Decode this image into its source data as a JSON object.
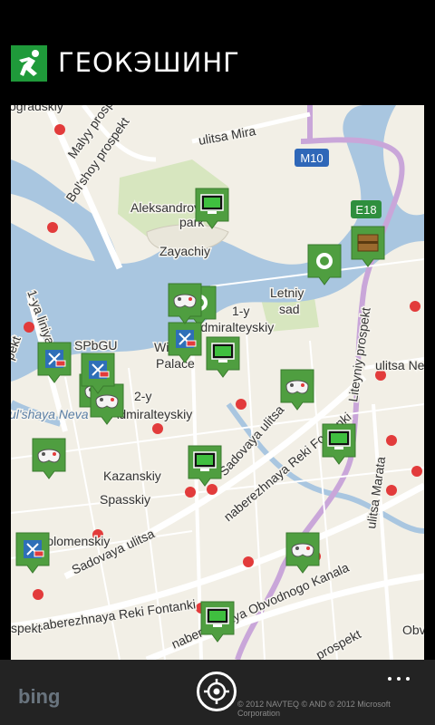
{
  "app": {
    "title": "ГЕОКЭШИНГ",
    "icon": "running-man-icon",
    "accent": "#1f9a3a"
  },
  "map": {
    "labels": [
      {
        "id": "l1",
        "text": "Malyy prospekt"
      },
      {
        "id": "l2",
        "text": "Bol'shoy prospekt"
      },
      {
        "id": "l3",
        "text": "ulitsa Mira"
      },
      {
        "id": "l4",
        "text": "Aleksandrovskiy"
      },
      {
        "id": "l5",
        "text": "park"
      },
      {
        "id": "l6",
        "text": "Zayachiy"
      },
      {
        "id": "l7",
        "text": "1-ya liniya"
      },
      {
        "id": "l8",
        "text": "SPbGU"
      },
      {
        "id": "l9",
        "text": "1-y"
      },
      {
        "id": "l10",
        "text": "Admiralteyskiy"
      },
      {
        "id": "l11",
        "text": "Letniy"
      },
      {
        "id": "l12",
        "text": "sad"
      },
      {
        "id": "l13",
        "text": "Liteyniy prospekt"
      },
      {
        "id": "l14",
        "text": "ulitsa Ne"
      },
      {
        "id": "l15",
        "text": "Winter"
      },
      {
        "id": "l16",
        "text": "Palace"
      },
      {
        "id": "l17",
        "text": "2-y"
      },
      {
        "id": "l18",
        "text": "Admiralteyskiy"
      },
      {
        "id": "l19",
        "text": "Sadovaya ulitsa"
      },
      {
        "id": "l20",
        "text": "naberezhnaya Reki Fontanki"
      },
      {
        "id": "l21",
        "text": "Kazanskiy"
      },
      {
        "id": "l22",
        "text": "Spasskiy"
      },
      {
        "id": "l23",
        "text": "ulitsa Marata"
      },
      {
        "id": "l24",
        "text": "Sadovaya ulitsa"
      },
      {
        "id": "l25",
        "text": "naberezhnaya Reki Fontanki"
      },
      {
        "id": "l26",
        "text": "naberezhnaya Obvodnogo Kanala"
      },
      {
        "id": "l27",
        "text": "naberezhnaya"
      },
      {
        "id": "l28",
        "text": "prospekt"
      },
      {
        "id": "l29",
        "text": "spekt"
      },
      {
        "id": "l30",
        "text": "Kolomenskiy"
      },
      {
        "id": "l31",
        "text": "ogradskiy"
      },
      {
        "id": "l32",
        "text": "pekt"
      },
      {
        "id": "l33",
        "text": "Obv"
      },
      {
        "id": "l34",
        "text": "ul'shaya Neva"
      }
    ],
    "road_shields": {
      "m10": "M10",
      "e18": "E18"
    },
    "colors": {
      "water": "#a9c6e0",
      "land": "#f2efe6",
      "green": "#cfe3b2",
      "road_major": "#ffffff",
      "road_purple": "#c9a6d9",
      "metro": "#e23b3b",
      "marker_green": "#4f9e40"
    },
    "markers": [
      {
        "id": "m1",
        "type": "virtual"
      },
      {
        "id": "m2",
        "type": "traditional"
      },
      {
        "id": "m3",
        "type": "mystery"
      },
      {
        "id": "m4",
        "type": "traditional"
      },
      {
        "id": "m5",
        "type": "multi"
      },
      {
        "id": "m6",
        "type": "event"
      },
      {
        "id": "m7",
        "type": "event"
      },
      {
        "id": "m8",
        "type": "multi"
      },
      {
        "id": "m9",
        "type": "multi"
      },
      {
        "id": "m10",
        "type": "virtual"
      },
      {
        "id": "m11",
        "type": "event"
      },
      {
        "id": "m12",
        "type": "event"
      },
      {
        "id": "m13",
        "type": "virtual"
      },
      {
        "id": "m14",
        "type": "virtual"
      },
      {
        "id": "m15",
        "type": "event"
      },
      {
        "id": "m16",
        "type": "multi"
      },
      {
        "id": "m17",
        "type": "event"
      },
      {
        "id": "m18",
        "type": "virtual"
      }
    ]
  },
  "appbar": {
    "locate_icon": "locate-me-icon",
    "more_icon": "more-icon",
    "watermark": "bing",
    "copyright": "© 2012 NAVTEQ © AND © 2012 Microsoft Corporation"
  }
}
